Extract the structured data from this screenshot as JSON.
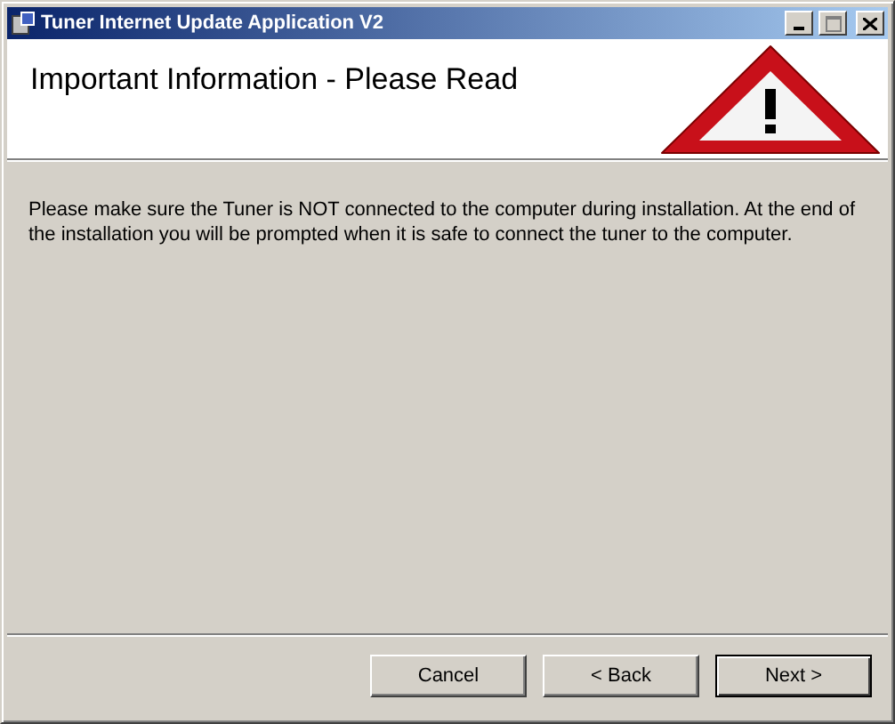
{
  "window": {
    "title": "Tuner Internet Update Application V2"
  },
  "header": {
    "title": "Important Information - Please Read"
  },
  "message": "Please make sure the Tuner is NOT connected to the computer during installation. At the end of the installation you will be prompted when it is safe to connect the tuner to the computer.",
  "buttons": [
    {
      "label": "Cancel",
      "default": false
    },
    {
      "label": "< Back",
      "default": false
    },
    {
      "label": "Next >",
      "default": true
    }
  ]
}
